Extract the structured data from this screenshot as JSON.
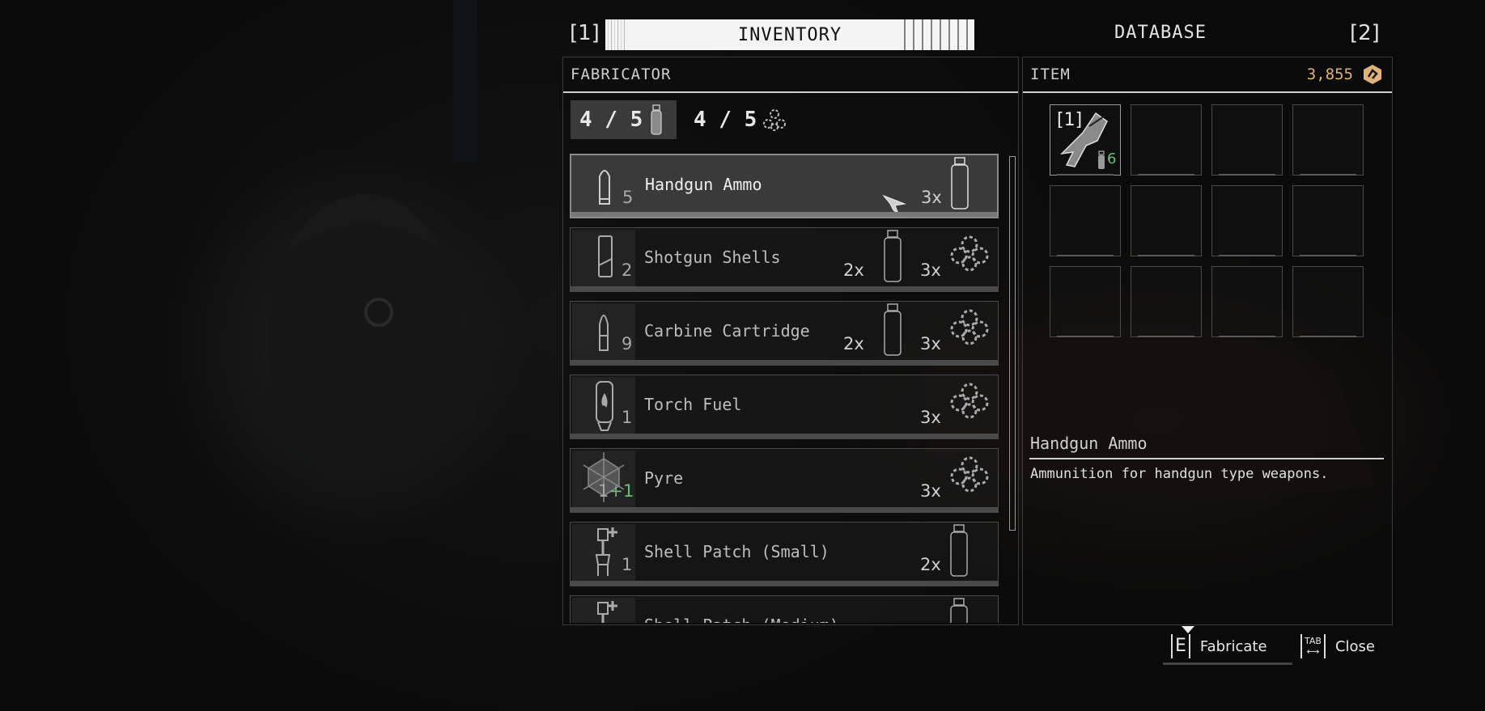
{
  "tabs": {
    "left_key": "[1]",
    "right_key": "[2]",
    "inventory": "INVENTORY",
    "database": "DATABASE"
  },
  "fabricator": {
    "title": "FABRICATOR",
    "counters": [
      {
        "text": "4 / 5",
        "icon": "canister-icon"
      },
      {
        "text": "4 / 5",
        "icon": "gear-cluster-icon"
      }
    ],
    "recipes": [
      {
        "name": "Handgun Ammo",
        "owned": "5",
        "cost1": "",
        "cost2": "3x",
        "icon": "handgun-ammo-icon"
      },
      {
        "name": "Shotgun Shells",
        "owned": "2",
        "cost1": "2x",
        "cost2": "3x",
        "icon": "shotgun-shell-icon"
      },
      {
        "name": "Carbine Cartridge",
        "owned": "9",
        "cost1": "2x",
        "cost2": "3x",
        "icon": "carbine-cartridge-icon"
      },
      {
        "name": "Torch Fuel",
        "owned": "1",
        "cost1": "",
        "cost2": "3x",
        "icon": "torch-fuel-icon"
      },
      {
        "name": "Pyre",
        "owned": "1",
        "owned_bonus": "+1",
        "cost1": "",
        "cost2": "3x",
        "icon": "pyre-icon"
      },
      {
        "name": "Shell Patch (Small)",
        "owned": "1",
        "cost1": "",
        "cost2": "2x",
        "icon": "shell-patch-icon"
      },
      {
        "name": "Shell Patch (Medium)",
        "owned": "",
        "cost1": "",
        "cost2": "",
        "icon": "shell-patch-icon"
      }
    ]
  },
  "item_panel": {
    "title": "ITEM",
    "currency": "3,855",
    "slot1_key": "[1]",
    "slot1_ammo": "6"
  },
  "description": {
    "title": "Handgun Ammo",
    "text": "Ammunition for handgun type weapons."
  },
  "hints": {
    "fabricate_key": "E",
    "fabricate_label": "Fabricate",
    "close_key": "TAB",
    "close_label": "Close"
  },
  "colors": {
    "accent_currency": "#e0b27a",
    "bonus_green": "#6fbf73",
    "panel_border": "#3a3a3a"
  }
}
